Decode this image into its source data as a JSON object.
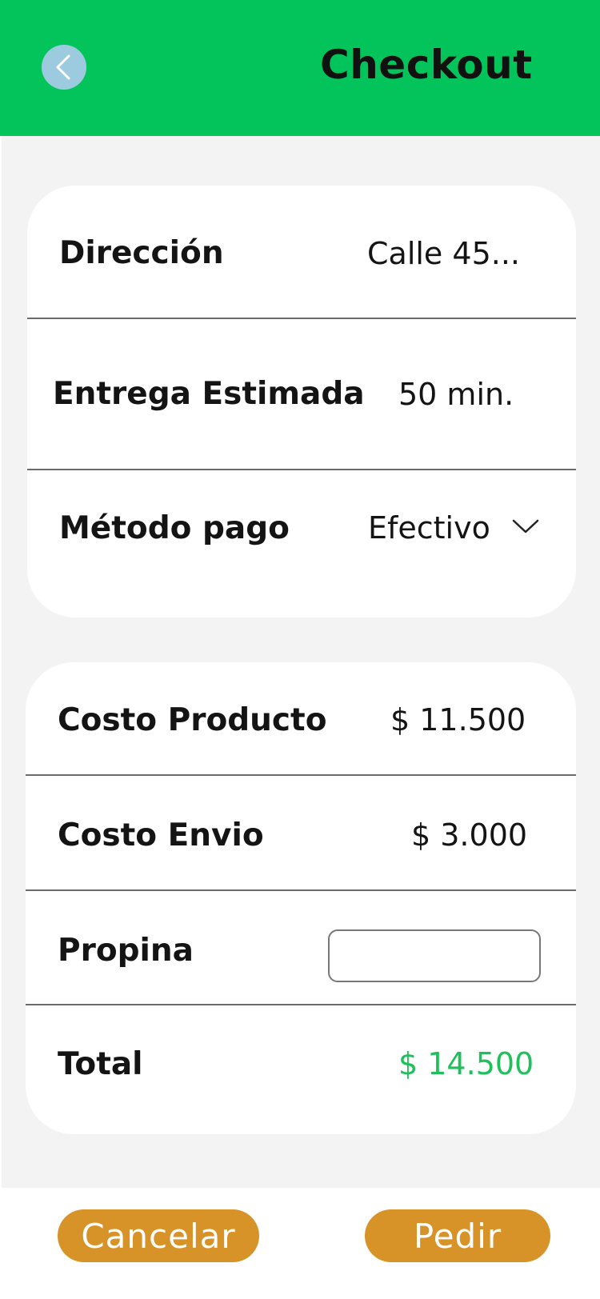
{
  "header": {
    "title": "Checkout",
    "back_icon": "chevron-left-icon"
  },
  "delivery": {
    "address_label": "Dirección",
    "address_value": "Calle 45...",
    "eta_label": "Entrega Estimada",
    "eta_value": "50 min.",
    "payment_label": "Método pago",
    "payment_value": "Efectivo",
    "payment_icon": "chevron-down-icon"
  },
  "summary": {
    "product_cost_label": "Costo Producto",
    "product_cost_value": "$ 11.500",
    "shipping_label": "Costo Envio",
    "shipping_value": "$ 3.000",
    "tip_label": "Propina",
    "tip_value": "",
    "total_label": "Total",
    "total_value": "$ 14.500"
  },
  "actions": {
    "cancel_label": "Cancelar",
    "order_label": "Pedir"
  },
  "colors": {
    "header": "#02c45a",
    "accent_green": "#1fbf5b",
    "button": "#d79228",
    "back_button": "#9ccbe0"
  }
}
